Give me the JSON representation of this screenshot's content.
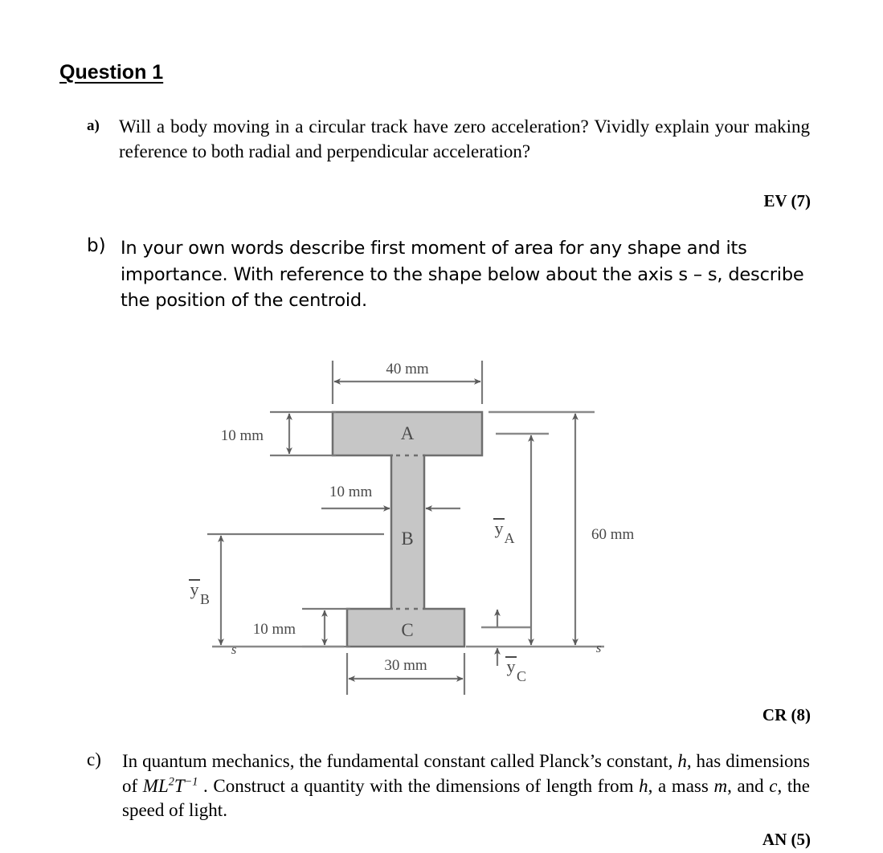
{
  "document": {
    "title": "Question 1"
  },
  "questions": [
    {
      "label": "a)",
      "text": "Will a body moving in a circular track have zero acceleration? Vividly explain your making reference to both radial and perpendicular acceleration?",
      "marks": "EV (7)"
    },
    {
      "label": "b)",
      "text": "In your own words describe first moment of area for any shape and its importance. With reference to the shape below about the axis s – s, describe the position of the centroid.",
      "marks": "CR (8)"
    },
    {
      "label": "c)",
      "text_part1": "In quantum mechanics, the fundamental constant called Planck’s constant, ",
      "var_h": "h",
      "text_part2": ", has dimensions of  ",
      "dimensions_M": "ML",
      "dimensions_exp1": "2",
      "dimensions_T": "T",
      "dimensions_exp2": "−1",
      "text_part3": " . Construct a quantity with the dimensions of length from ",
      "var_h2": "h",
      "text_part4": ", a mass ",
      "var_m": "m",
      "text_part5": ", and ",
      "var_c": "c",
      "text_part6": ", the speed of light.",
      "marks": "AN (5)"
    }
  ],
  "diagram": {
    "name": "i-beam-cross-section",
    "section_labels": {
      "flange_top": "A",
      "web": "B",
      "flange_bottom": "C"
    },
    "dimensions": {
      "top_flange_width": "40 mm",
      "top_flange_thickness": "10 mm",
      "web_thickness": "10 mm",
      "bottom_flange_thickness": "10 mm",
      "bottom_flange_width": "30 mm",
      "overall_height": "60 mm"
    },
    "centroid_labels": {
      "y_bar_A_base": "y",
      "y_bar_A_sub": "A",
      "y_bar_B_base": "y",
      "y_bar_B_sub": "B",
      "y_bar_C_base": "y",
      "y_bar_C_sub": "C"
    },
    "axis_labels": {
      "axis_left": "s",
      "axis_right": "s"
    },
    "colors": {
      "fill": "#c6c6c6",
      "outline": "#6e6e6e",
      "dimension_line": "#7a7a7a",
      "text": "#4a4a4a"
    }
  }
}
